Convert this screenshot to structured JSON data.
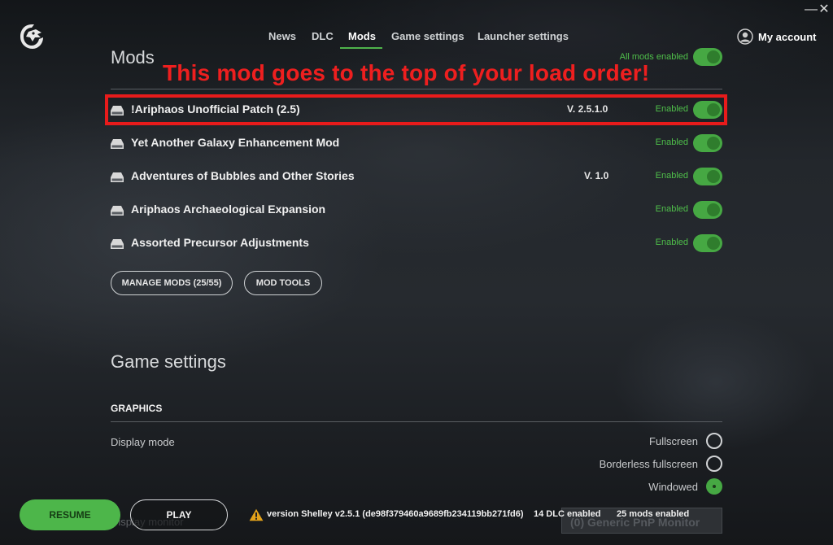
{
  "window": {
    "minimize": "—",
    "close": "✕"
  },
  "nav": {
    "items": [
      "News",
      "DLC",
      "Mods",
      "Game settings",
      "Launcher settings"
    ],
    "active": "Mods",
    "account": "My account"
  },
  "mods": {
    "title": "Mods",
    "all_label": "All mods enabled",
    "annotation": "This mod goes to the top of your load order!",
    "list": [
      {
        "name": "!Ariphaos Unofficial Patch (2.5)",
        "version": "V. 2.5.1.0",
        "status": "Enabled",
        "enabled": true
      },
      {
        "name": "Yet Another Galaxy Enhancement Mod",
        "version": "",
        "status": "Enabled",
        "enabled": true
      },
      {
        "name": "Adventures of Bubbles and Other Stories",
        "version": "V. 1.0",
        "status": "Enabled",
        "enabled": true
      },
      {
        "name": "Ariphaos Archaeological Expansion",
        "version": "",
        "status": "Enabled",
        "enabled": true
      },
      {
        "name": "Assorted Precursor Adjustments",
        "version": "",
        "status": "Enabled",
        "enabled": true
      }
    ],
    "manage_button": "MANAGE MODS (25/55)",
    "tools_button": "MOD TOOLS"
  },
  "game_settings": {
    "title": "Game settings",
    "graphics_header": "GRAPHICS",
    "display_mode_label": "Display mode",
    "display_modes": [
      "Fullscreen",
      "Borderless fullscreen",
      "Windowed"
    ],
    "display_mode_selected": "Windowed",
    "display_monitor_label": "Display monitor",
    "monitor_value": "(0) Generic PnP Monitor"
  },
  "bottom_bar": {
    "resume": "RESUME",
    "play": "PLAY",
    "version": "version Shelley v2.5.1 (de98f379460a9689fb234119bb271fd6)",
    "dlc": "14 DLC enabled",
    "mods": "25 mods enabled"
  },
  "colors": {
    "accent": "#4db64a",
    "annotation": "#e81b1b"
  }
}
